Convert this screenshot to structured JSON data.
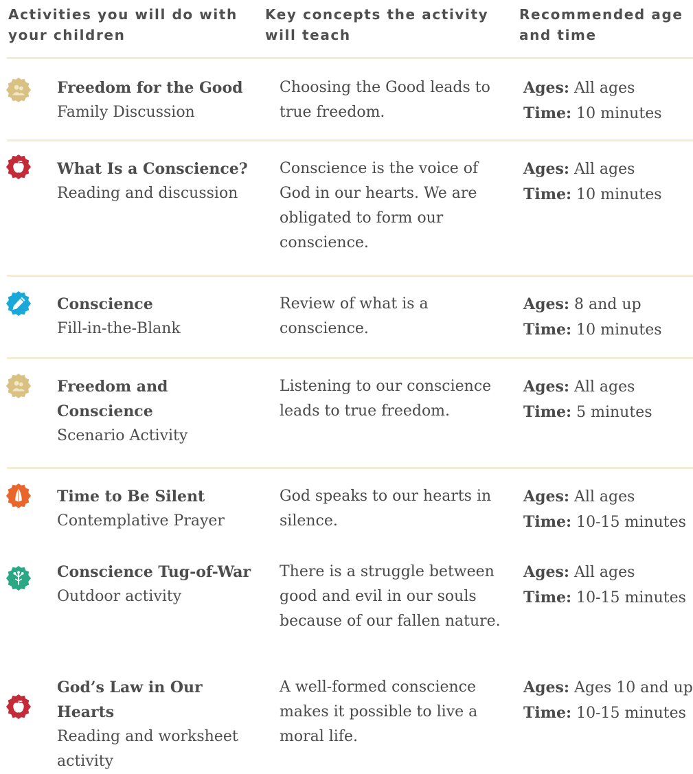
{
  "header": {
    "col1": "Activities you will do with your children",
    "col2": "Key concepts the activity will teach",
    "col3": "Recommended age and time"
  },
  "labels": {
    "ages": "Ages:",
    "time": "Time:"
  },
  "colors": {
    "family": "#d9c184",
    "apple": "#c42b38",
    "pencil": "#1aa8d9",
    "prayer": "#e8662c",
    "outdoor": "#2aa885",
    "separator": "#f5ecd6"
  },
  "rows": [
    {
      "icon": "family-icon",
      "title": "Freedom for the Good",
      "subtitle": "Family Discussion",
      "concept": "Choosing the Good leads to true freedom.",
      "ages": "All ages",
      "time": "10 minutes"
    },
    {
      "icon": "apple-icon",
      "title": "What Is a Conscience?",
      "subtitle": "Reading and discussion",
      "concept": "Conscience is the voice of God in our hearts. We are obligated to form our conscience.",
      "ages": "All ages",
      "time": "10 minutes"
    },
    {
      "icon": "pencil-icon",
      "title": "Conscience",
      "subtitle": "Fill-in-the-Blank",
      "concept": "Review of what is a conscience.",
      "ages": "8 and up",
      "time": "10 minutes"
    },
    {
      "icon": "family-icon",
      "title": "Freedom and Conscience",
      "subtitle": "Scenario Activity",
      "concept": "Listening to our conscience leads to true freedom.",
      "ages": "All ages",
      "time": "5 minutes"
    },
    {
      "icon": "praying-hands-icon",
      "title": "Time to Be Silent",
      "subtitle": "Contemplative Prayer",
      "concept": "God speaks to our hearts in silence.",
      "ages": "All ages",
      "time": "10-15 minutes"
    },
    {
      "icon": "tree-icon",
      "title": "Conscience Tug-of-War",
      "subtitle": "Outdoor activity",
      "concept": "There is a struggle between good and evil in our souls because of our fallen nature.",
      "ages": "All ages",
      "time": "10-15 minutes"
    },
    {
      "icon": "apple-icon",
      "title": "God’s Law in Our Hearts",
      "subtitle": "Reading and worksheet activity",
      "concept": "A well-formed conscience makes it possible to live a moral life.",
      "ages": "Ages 10 and up",
      "time": "10-15 minutes"
    }
  ]
}
